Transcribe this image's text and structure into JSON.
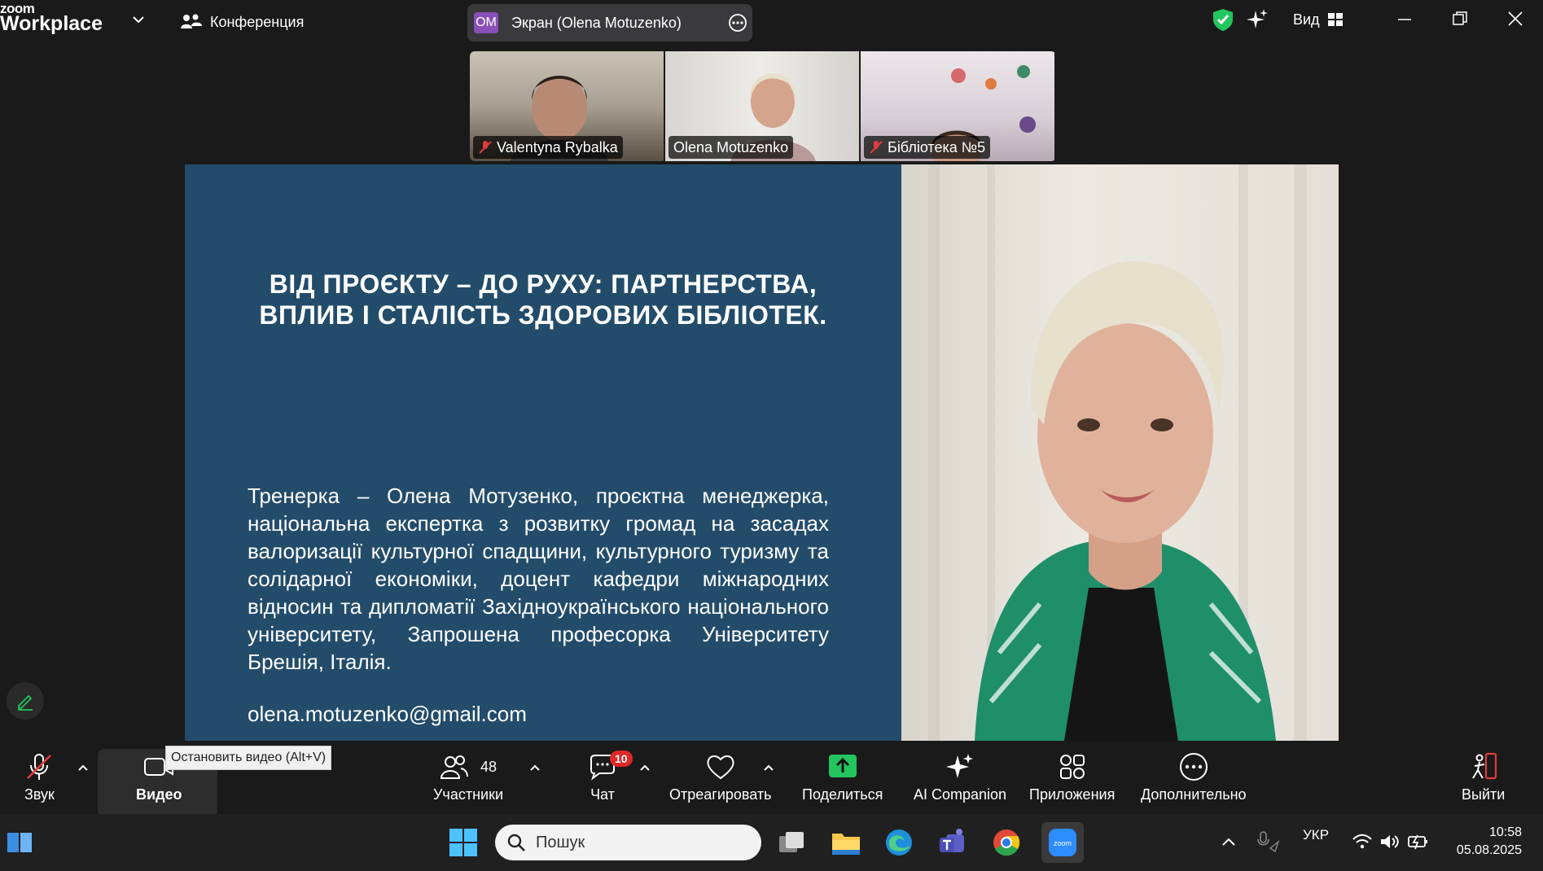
{
  "app": {
    "logo_top": "zoom",
    "logo_bottom": "Workplace"
  },
  "titlebar": {
    "conference_label": "Конференция",
    "share_initials": "OM",
    "share_label": "Экран (Olena Motuzenko)",
    "view_label": "Вид"
  },
  "participants_strip": [
    {
      "name": "Valentyna Rybalka",
      "muted": true
    },
    {
      "name": "Olena Motuzenko",
      "muted": false
    },
    {
      "name": "Бібліотека №5",
      "muted": true
    }
  ],
  "slide": {
    "title": "ВІД ПРОЄКТУ  – ДО РУХУ: ПАРТНЕРСТВА, ВПЛИВ І СТАЛІСТЬ ЗДОРОВИХ БІБЛІОТЕК.",
    "body": "Тренерка – Олена Мотузенко, проєктна менеджерка, національна експертка з розвитку громад на засадах валоризації культурної спадщини, культурного туризму та солідарної економіки, доцент кафедри міжнародних відносин та дипломатії Західноукраїнського національного університету, Запрошена професорка Університету Брешія, Італія.",
    "email": "olena.motuzenko@gmail.com"
  },
  "toolbar": {
    "audio_label": "Звук",
    "video_label": "Видео",
    "video_tooltip": "Остановить видео (Alt+V)",
    "participants_label": "Участники",
    "participants_count": "48",
    "chat_label": "Чат",
    "chat_badge": "10",
    "react_label": "Отреагировать",
    "share_label": "Поделиться",
    "ai_label": "AI Companion",
    "apps_label": "Приложения",
    "more_label": "Дополнительно",
    "leave_label": "Выйти"
  },
  "taskbar": {
    "search_placeholder": "Пошук",
    "language": "УКР",
    "time": "10:58",
    "date": "05.08.2025"
  },
  "colors": {
    "slide_bg": "#234c6b",
    "share_green": "#23c55e",
    "badge_red": "#e02828",
    "leave_red": "#e03c3c"
  }
}
